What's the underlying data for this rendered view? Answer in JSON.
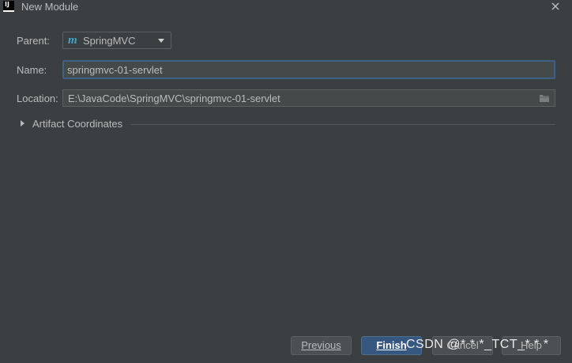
{
  "window": {
    "title": "New Module",
    "app_icon_text": "IJ"
  },
  "form": {
    "parent_label": "Parent:",
    "parent_value": "SpringMVC",
    "parent_icon_text": "m",
    "name_label": "Name:",
    "name_value": "springmvc-01-servlet",
    "location_label": "Location:",
    "location_value": "E:\\JavaCode\\SpringMVC\\springmvc-01-servlet",
    "artifact_label": "Artifact Coordinates"
  },
  "buttons": {
    "previous": "Previous",
    "finish": "Finish",
    "cancel": "Cancel",
    "help": "Help"
  },
  "watermark": {
    "text": "CSDN @* * *_TCT_* * *"
  },
  "colors": {
    "background": "#3c3f41",
    "accent": "#365880",
    "focus_border": "#3d6185",
    "maven_icon": "#3fa3c8"
  }
}
